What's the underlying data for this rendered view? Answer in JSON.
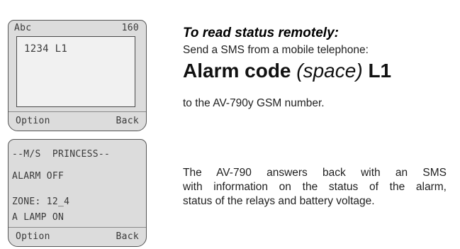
{
  "screen1": {
    "header_left": "Abc",
    "header_right": "160",
    "message": "1234 L1",
    "soft_left": "Option",
    "soft_right": "Back"
  },
  "screen2": {
    "line1": "--M/S  PRINCESS--",
    "line2": "ALARM OFF",
    "line3": "ZONE: 12_4",
    "line4": "A LAMP ON",
    "soft_left": "Option",
    "soft_right": "Back"
  },
  "text": {
    "heading": "To read status remotely:",
    "intro": "Send a SMS from a mobile telephone:",
    "command_part1": "Alarm code",
    "command_part2": "(space)",
    "command_part3": "L1",
    "to_number": "to the AV-790y GSM number.",
    "para_line1": "The AV-790 answers back with an SMS",
    "para_line2": "with information on the status of the alarm,",
    "para_line3": "status of the relays and battery voltage."
  }
}
